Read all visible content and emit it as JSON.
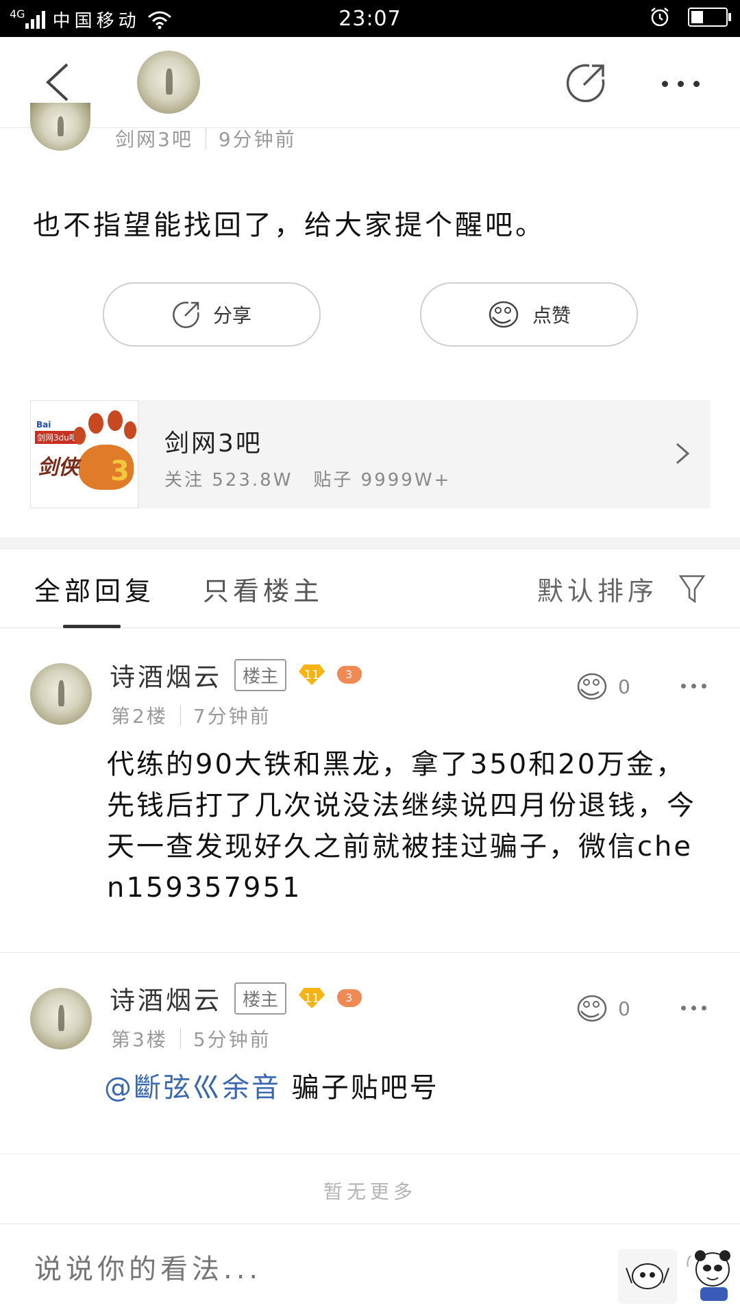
{
  "status_bar": {
    "network": "4G",
    "carrier": "中国移动",
    "time": "23:07",
    "battery_level": 0.35
  },
  "nav": {
    "back_icon": "chevron-left-icon",
    "share_icon": "share-arrow-icon",
    "more_icon": "more-dots-icon"
  },
  "post": {
    "forum_name": "剑网3吧",
    "time_ago": "9分钟前",
    "text": "也不指望能找回了，给大家提个醒吧。",
    "share_label": "分享",
    "like_label": "点赞"
  },
  "forum_card": {
    "logo_text_top": "Bai",
    "logo_text_tag": "剑网3du吧",
    "name": "剑网3吧",
    "follow_label": "关注 523.8W",
    "posts_label": "贴子 9999W+"
  },
  "tabs": {
    "all_replies": "全部回复",
    "owner_only": "只看楼主",
    "sort": "默认排序"
  },
  "replies": [
    {
      "author": "诗酒烟云",
      "badge": "楼主",
      "level": "11",
      "game_level": "3",
      "floor": "第2楼",
      "time": "7分钟前",
      "likes": "0",
      "text": "代练的90大铁和黑龙，拿了350和20万金，先钱后打了几次说没法继续说四月份退钱，今天一查发现好久之前就被挂过骗子，微信chen159357951"
    },
    {
      "author": "诗酒烟云",
      "badge": "楼主",
      "level": "11",
      "game_level": "3",
      "floor": "第3楼",
      "time": "5分钟前",
      "likes": "0",
      "mention": "@斷弦巛余音",
      "text": " 骗子贴吧号"
    }
  ],
  "no_more": "暂无更多",
  "input": {
    "placeholder": "说说你的看法..."
  },
  "colors": {
    "accent_link": "#3a67b1",
    "tab_indicator": "#333333",
    "level_badge": "#f6b412",
    "game_badge": "#f08a55"
  }
}
